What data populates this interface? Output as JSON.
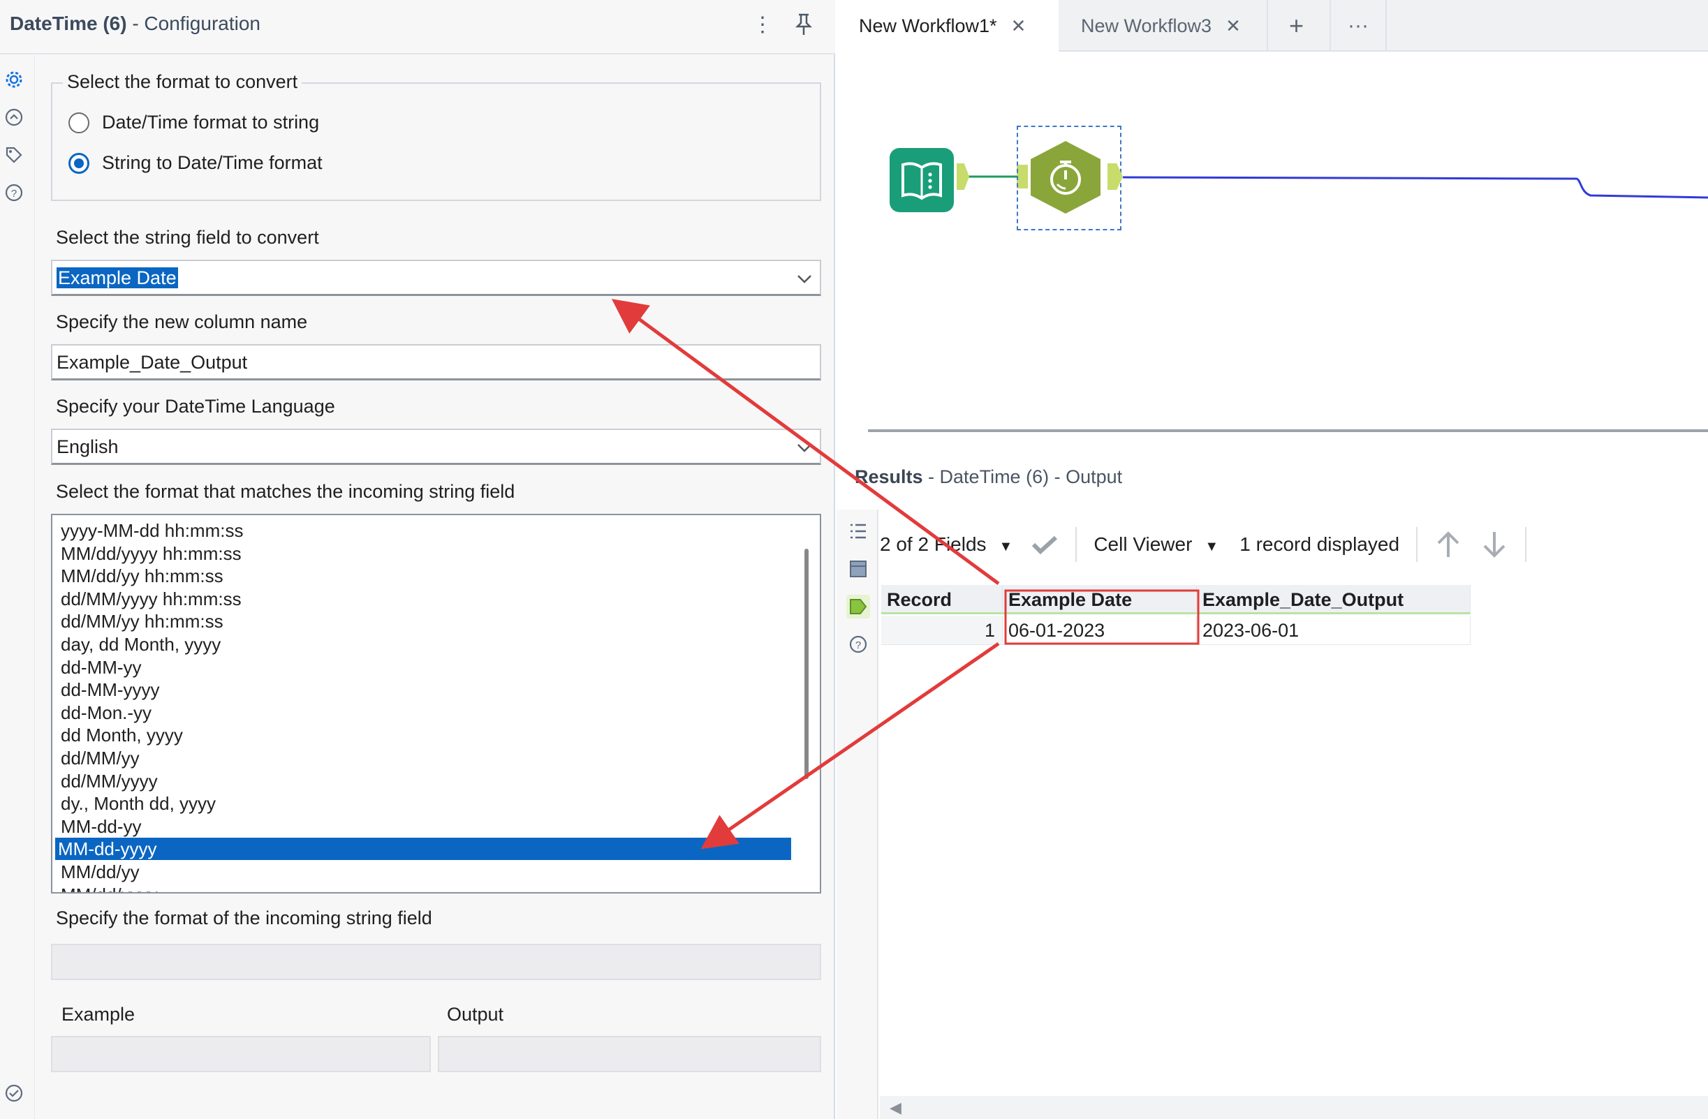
{
  "config": {
    "title_tool": "DateTime (6)",
    "title_suffix": " - Configuration",
    "menu_icon": "more-vertical-icon",
    "pin_icon": "pin-icon",
    "rail_icons": [
      "gear-icon",
      "annotation-icon",
      "tag-icon",
      "help-icon"
    ],
    "status_icon": "check-circle-icon",
    "format_group": {
      "legend": "Select the format to convert",
      "options": [
        {
          "label": "Date/Time format to string",
          "checked": false
        },
        {
          "label": "String to Date/Time format",
          "checked": true
        }
      ]
    },
    "string_field": {
      "label": "Select the string field to convert",
      "value": "Example Date"
    },
    "new_column": {
      "label": "Specify the new column name",
      "value": "Example_Date_Output"
    },
    "language": {
      "label": "Specify your DateTime Language",
      "value": "English"
    },
    "format_list": {
      "label": "Select the format that matches the incoming string field",
      "items": [
        "yyyy-MM-dd hh:mm:ss",
        "MM/dd/yyyy hh:mm:ss",
        "MM/dd/yy hh:mm:ss",
        "dd/MM/yyyy hh:mm:ss",
        "dd/MM/yy hh:mm:ss",
        "day, dd Month, yyyy",
        "dd-MM-yy",
        "dd-MM-yyyy",
        "dd-Mon.-yy",
        "dd Month, yyyy",
        "dd/MM/yy",
        "dd/MM/yyyy",
        "dy., Month dd, yyyy",
        "MM-dd-yy",
        "MM-dd-yyyy",
        "MM/dd/yy",
        "MM/dd/yyyy"
      ],
      "selected": "MM-dd-yyyy"
    },
    "incoming_format": {
      "label": "Specify the format of the incoming string field",
      "value": ""
    },
    "example": {
      "label": "Example",
      "value": ""
    },
    "output": {
      "label": "Output",
      "value": ""
    }
  },
  "tabs": [
    {
      "label": "New Workflow1*",
      "active": true
    },
    {
      "label": "New Workflow3",
      "active": false
    }
  ],
  "tab_actions": {
    "add_icon": "plus-icon",
    "more_icon": "more-horizontal-icon"
  },
  "workflow": {
    "tools": [
      {
        "name": "Input Data",
        "icon": "book-icon",
        "color": "#1a9e7a"
      },
      {
        "name": "DateTime",
        "icon": "stopwatch-icon",
        "color": "#8aa63b"
      }
    ],
    "connection_color": "#2f3bd8"
  },
  "results": {
    "title_bold": "Results",
    "title_rest": " - DateTime (6) - Output",
    "rail_icons": [
      "list-icon",
      "table-icon",
      "tag-active-icon",
      "help-icon"
    ],
    "fields_label": "2 of 2 Fields",
    "cell_viewer_label": "Cell Viewer",
    "record_count": "1 record displayed",
    "columns": [
      "Record",
      "Example Date",
      "Example_Date_Output"
    ],
    "rows": [
      {
        "record": "1",
        "example_date": "06-01-2023",
        "output": "2023-06-01"
      }
    ]
  },
  "annotation_color": "#e23b3b"
}
